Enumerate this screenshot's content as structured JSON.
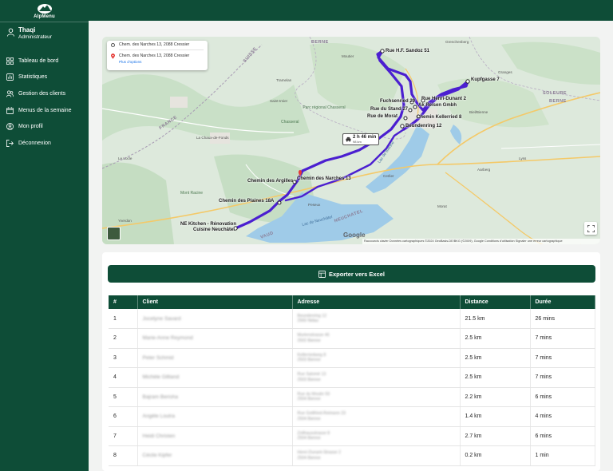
{
  "app": {
    "name": "AlpMenu"
  },
  "user": {
    "name": "Thaqi",
    "role": "Administrateur"
  },
  "sidebar": {
    "items": [
      {
        "label": "Tableau de bord",
        "icon": "dashboard-icon"
      },
      {
        "label": "Statistiques",
        "icon": "stats-icon"
      },
      {
        "label": "Gestion des clients",
        "icon": "users-icon"
      },
      {
        "label": "Menus de la semaine",
        "icon": "calendar-icon"
      },
      {
        "label": "Mon profil",
        "icon": "profile-icon"
      },
      {
        "label": "Déconnexion",
        "icon": "logout-icon"
      }
    ]
  },
  "map": {
    "origin": "Chem. des Narches 13, 2088 Cressier",
    "destination": "Chem. des Narches 13, 2088 Cressier",
    "options_link": "Plus d'options",
    "duration": "2 h 46 min",
    "distance_small": "98 km",
    "stops": [
      "Rue H.F. Sandoz 51",
      "Kupfgasse 7",
      "Fuchsenried 29",
      "Rue Henri-Dunant 2",
      "Ak Reisen Gmbh",
      "Rue du Stand 27",
      "Chemin Kellerried 8",
      "Rue de Morat",
      "Beundenring 12",
      "Chemin des Argilles",
      "Chemin des Narches 13",
      "Chemin des Plaines 18A",
      "NE Kitchen - Rénovation",
      "Cuisine Neuchâtel"
    ],
    "google_logo": "Google",
    "attribution": "Raccourcis clavier   Données cartographiques ©2024 GeoBasis-DE/BKG (©2009), Google   Conditions d'utilisation   Signaler une erreur cartographique",
    "regions": [
      "BERNE",
      "SUISSE",
      "FRANCE",
      "SOLEURE",
      "BERNE",
      "NEUCHATEL",
      "VAUD"
    ],
    "lakes": [
      "Lac de Bienne",
      "Lac de Neuchâtel"
    ],
    "parks": [
      "Parc régional Chasseral",
      "Chasseral",
      "Mont Racine"
    ],
    "towns": [
      "Grenchenberg",
      "Biel/Bienne",
      "Lyss",
      "Cerlier",
      "Le Locle",
      "La Chaux-de-Fonds",
      "Saint-Imier",
      "Tramelan",
      "Moutier",
      "Granges",
      "Aarberg",
      "Morat",
      "Peseux",
      "Yverdon"
    ]
  },
  "export_label": "Exporter vers Excel",
  "table": {
    "headers": [
      "#",
      "Client",
      "Adresse",
      "Distance",
      "Durée"
    ],
    "rows": [
      {
        "num": "1",
        "client": "Jocelyne Savard",
        "addr1": "Beundenring 12",
        "addr2": "2560 Nidau",
        "distance": "21.5 km",
        "duration": "26 mins"
      },
      {
        "num": "2",
        "client": "Marie-Anne Reymond",
        "addr1": "Murtenstrasse 46",
        "addr2": "2502 Bienne",
        "distance": "2.5 km",
        "duration": "7 mins"
      },
      {
        "num": "3",
        "client": "Peter Schmid",
        "addr1": "Kellerriedweg 8",
        "addr2": "2503 Bienne",
        "distance": "2.5 km",
        "duration": "7 mins"
      },
      {
        "num": "4",
        "client": "Michèle Gilliand",
        "addr1": "Rue Salomé 13",
        "addr2": "2503 Bienne",
        "distance": "2.5 km",
        "duration": "7 mins"
      },
      {
        "num": "5",
        "client": "Bajram Berisha",
        "addr1": "Rue du Moulin 93",
        "addr2": "2504 Bienne",
        "distance": "2.2 km",
        "duration": "6 mins"
      },
      {
        "num": "6",
        "client": "Angèle Loutra",
        "addr1": "Rue Gottfried-Reimann 23",
        "addr2": "2504 Bienne",
        "distance": "1.4 km",
        "duration": "4 mins"
      },
      {
        "num": "7",
        "client": "Heidi Christen",
        "addr1": "Zollhausstrasse 8",
        "addr2": "2504 Bienne",
        "distance": "2.7 km",
        "duration": "6 mins"
      },
      {
        "num": "8",
        "client": "Cécile Kipfer",
        "addr1": "Henri-Dunant-Strasse 2",
        "addr2": "2504 Bienne",
        "distance": "0.2 km",
        "duration": "1 min"
      }
    ]
  },
  "colors": {
    "primary": "#0e4d37",
    "route": "#4b1fd0",
    "lake": "#9fcbe8"
  }
}
